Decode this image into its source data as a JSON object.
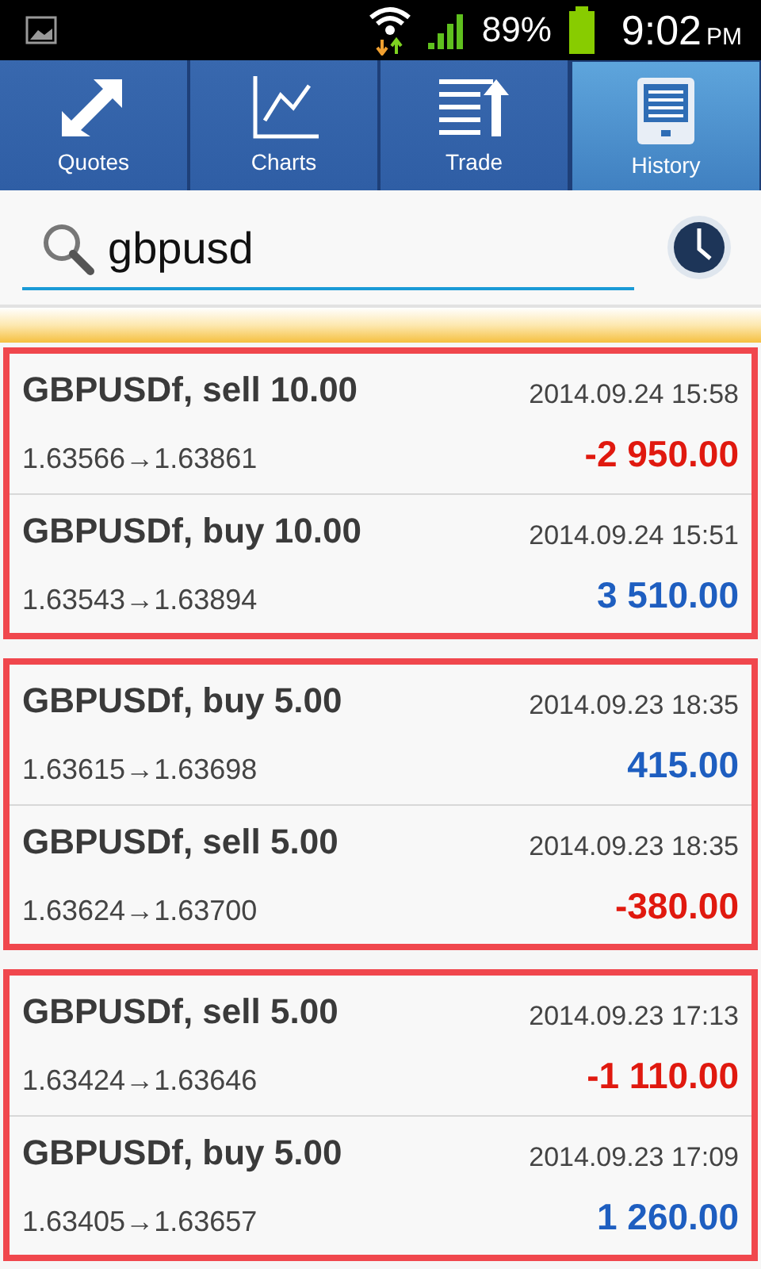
{
  "status_bar": {
    "battery_text": "89%",
    "time": "9:02",
    "ampm": "PM"
  },
  "tabs": [
    {
      "label": "Quotes",
      "kind": "quotes",
      "selected": false
    },
    {
      "label": "Charts",
      "kind": "charts",
      "selected": false
    },
    {
      "label": "Trade",
      "kind": "trade",
      "selected": false
    },
    {
      "label": "History",
      "kind": "history",
      "selected": true
    }
  ],
  "search": {
    "value": "gbpusd"
  },
  "groups": [
    {
      "highlighted": true,
      "trades": [
        {
          "title": "GBPUSDf, sell 10.00",
          "time": "2014.09.24 15:58",
          "prices": "1.63566→1.63861",
          "profit": "-2 950.00",
          "kind": "loss"
        },
        {
          "title": "GBPUSDf, buy 10.00",
          "time": "2014.09.24 15:51",
          "prices": "1.63543→1.63894",
          "profit": "3 510.00",
          "kind": "profit"
        }
      ]
    },
    {
      "highlighted": true,
      "trades": [
        {
          "title": "GBPUSDf, buy 5.00",
          "time": "2014.09.23 18:35",
          "prices": "1.63615→1.63698",
          "profit": "415.00",
          "kind": "profit"
        },
        {
          "title": "GBPUSDf, sell 5.00",
          "time": "2014.09.23 18:35",
          "prices": "1.63624→1.63700",
          "profit": "-380.00",
          "kind": "loss"
        }
      ]
    },
    {
      "highlighted": true,
      "trades": [
        {
          "title": "GBPUSDf, sell 5.00",
          "time": "2014.09.23 17:13",
          "prices": "1.63424→1.63646",
          "profit": "-1 110.00",
          "kind": "loss"
        },
        {
          "title": "GBPUSDf, buy 5.00",
          "time": "2014.09.23 17:09",
          "prices": "1.63405→1.63657",
          "profit": "1 260.00",
          "kind": "profit"
        }
      ]
    }
  ]
}
